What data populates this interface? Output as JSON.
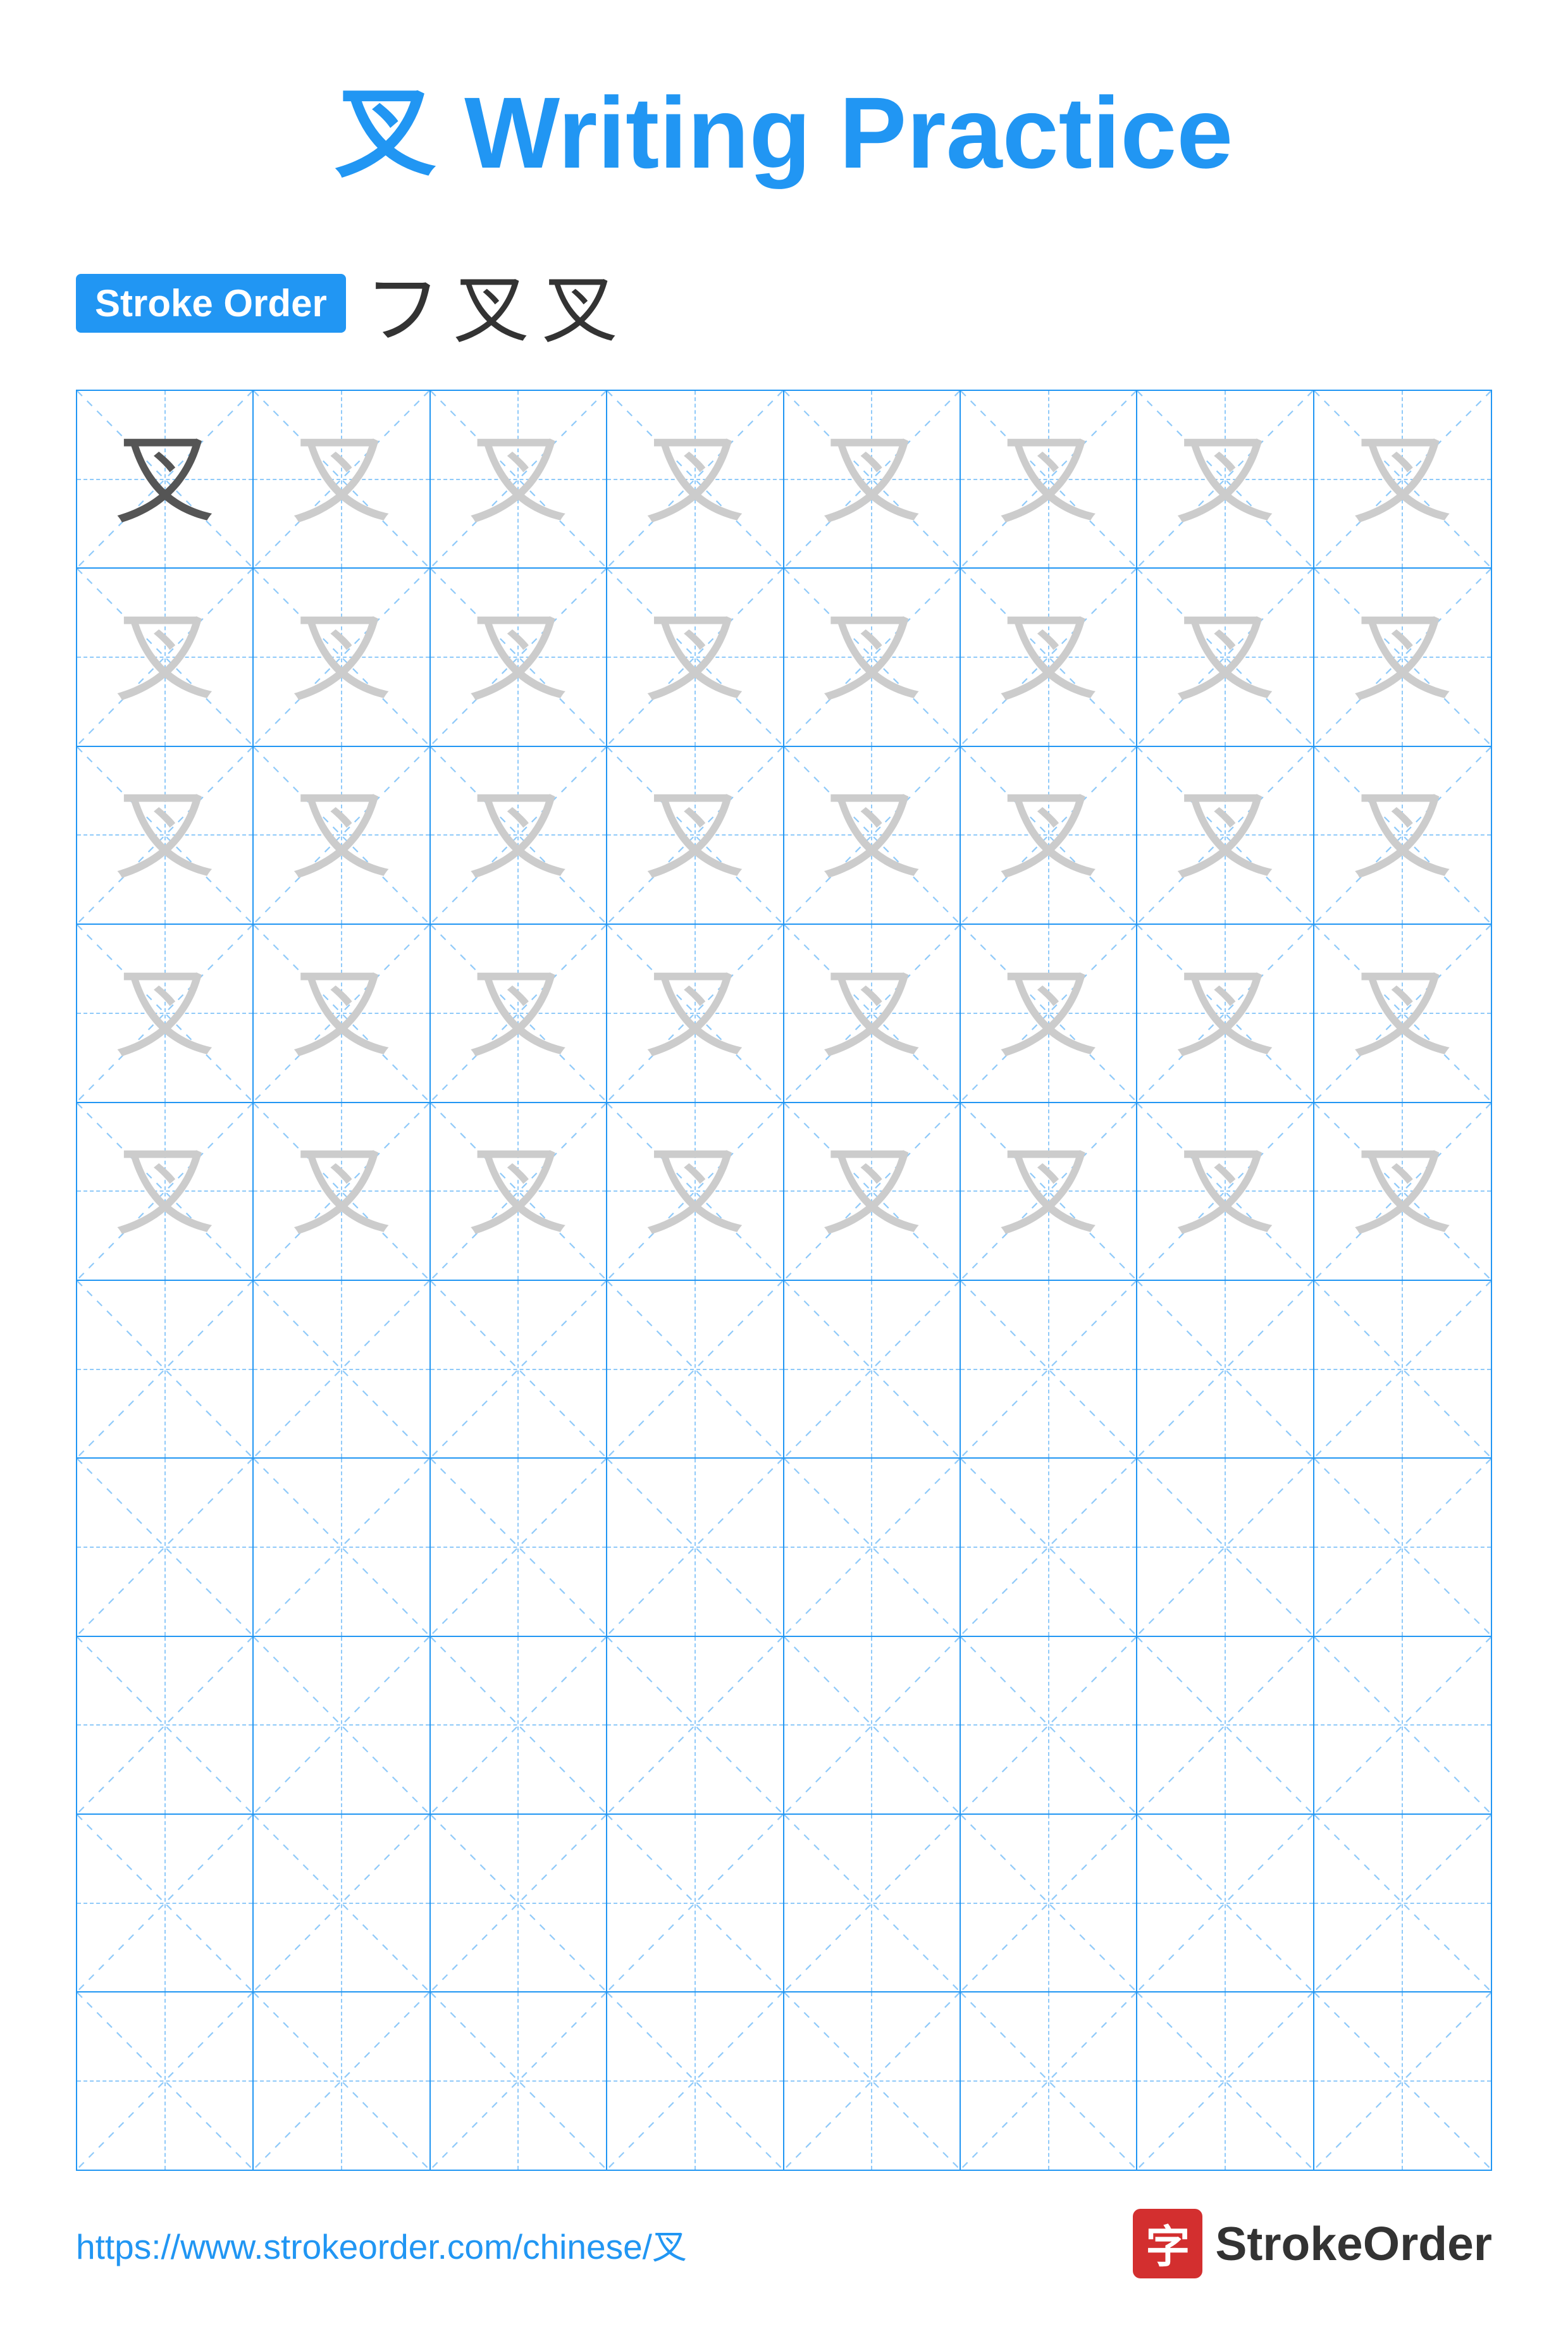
{
  "title": {
    "char": "叉",
    "label": "Writing Practice",
    "full": "叉 Writing Practice"
  },
  "stroke_order": {
    "badge": "Stroke Order",
    "strokes": [
      "フ",
      "叉",
      "叉"
    ]
  },
  "grid": {
    "rows": 10,
    "cols": 8,
    "filled_rows": 5,
    "char": "叉"
  },
  "footer": {
    "url": "https://www.strokeorder.com/chinese/叉",
    "logo_char": "字",
    "logo_name": "StrokeOrder"
  }
}
